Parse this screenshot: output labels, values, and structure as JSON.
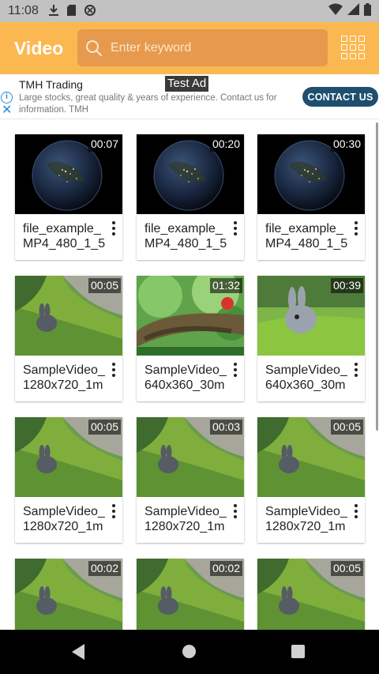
{
  "status_bar": {
    "time": "11:08",
    "icons": [
      "download-icon",
      "sd-card-icon",
      "data-saver-icon"
    ],
    "right_icons": [
      "wifi-icon",
      "signal-icon",
      "battery-icon"
    ]
  },
  "app_bar": {
    "title": "Video",
    "search_placeholder": "Enter keyword",
    "accent_color": "#fcb850",
    "search_bg_color": "#e79a4d"
  },
  "ad": {
    "advertiser": "TMH Trading",
    "label": "Test Ad",
    "description": "Large stocks, great quality & years of experience. Contact us for information. TMH",
    "cta": "CONTACT US",
    "cta_color": "#1f4f6e"
  },
  "videos": [
    {
      "title": "file_example_\nMP4_480_1_5",
      "duration": "00:07",
      "thumb": "earth"
    },
    {
      "title": "file_example_\nMP4_480_1_5",
      "duration": "00:20",
      "thumb": "earth"
    },
    {
      "title": "file_example_\nMP4_480_1_5",
      "duration": "00:30",
      "thumb": "earth"
    },
    {
      "title": "SampleVideo_\n1280x720_1m",
      "duration": "00:05",
      "thumb": "bunny"
    },
    {
      "title": "SampleVideo_\n640x360_30m",
      "duration": "01:32",
      "thumb": "forest"
    },
    {
      "title": "SampleVideo_\n640x360_30m",
      "duration": "00:39",
      "thumb": "bunny-big"
    },
    {
      "title": "SampleVideo_\n1280x720_1m",
      "duration": "00:05",
      "thumb": "bunny"
    },
    {
      "title": "SampleVideo_\n1280x720_1m",
      "duration": "00:03",
      "thumb": "bunny"
    },
    {
      "title": "SampleVideo_\n1280x720_1m",
      "duration": "00:05",
      "thumb": "bunny"
    },
    {
      "title": "",
      "duration": "00:02",
      "thumb": "bunny"
    },
    {
      "title": "",
      "duration": "00:02",
      "thumb": "bunny"
    },
    {
      "title": "",
      "duration": "00:05",
      "thumb": "bunny"
    }
  ]
}
